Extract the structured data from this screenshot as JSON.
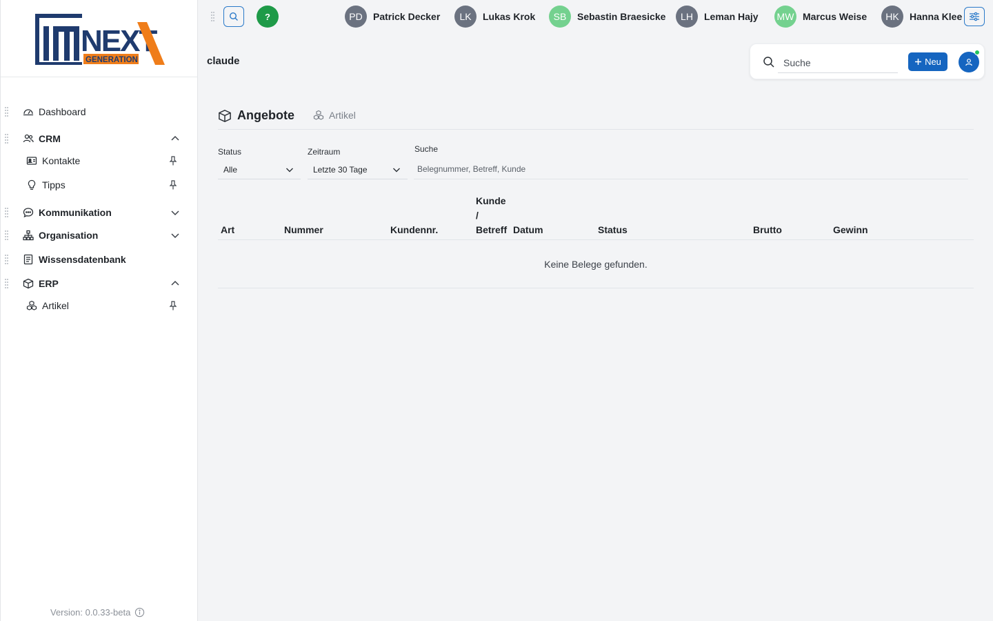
{
  "logo": {
    "text_main": "NEXT",
    "text_sub": "GENERATION"
  },
  "sidebar": {
    "items": [
      {
        "label": "Dashboard"
      },
      {
        "label": "CRM"
      },
      {
        "label": "Kontakte"
      },
      {
        "label": "Tipps"
      },
      {
        "label": "Kommunikation"
      },
      {
        "label": "Organisation"
      },
      {
        "label": "Wissensdatenbank"
      },
      {
        "label": "ERP"
      },
      {
        "label": "Artikel"
      }
    ],
    "version": "Version: 0.0.33-beta"
  },
  "topbar": {
    "help_label": "?",
    "users": [
      {
        "initials": "PD",
        "name": "Patrick Decker",
        "color": "#6b7280"
      },
      {
        "initials": "LK",
        "name": "Lukas Krok",
        "color": "#6b7280"
      },
      {
        "initials": "SB",
        "name": "Sebastin Braesicke",
        "color": "#74d18f"
      },
      {
        "initials": "LH",
        "name": "Leman Hajy",
        "color": "#6b7280"
      },
      {
        "initials": "MW",
        "name": "Marcus Weise",
        "color": "#74d18f"
      },
      {
        "initials": "HK",
        "name": "Hanna Klee",
        "color": "#6b7280"
      }
    ]
  },
  "header": {
    "current_user": "claude",
    "search_placeholder": "Suche",
    "new_label": "Neu"
  },
  "tabs": {
    "active": "Angebote",
    "second": "Artikel"
  },
  "filters": {
    "status_label": "Status",
    "status_value": "Alle",
    "period_label": "Zeitraum",
    "period_value": "Letzte 30 Tage",
    "search_label": "Suche",
    "search_placeholder": "Belegnummer, Betreff, Kunde"
  },
  "table": {
    "columns": {
      "art": "Art",
      "nummer": "Nummer",
      "kundennr": "Kundennr.",
      "kunde_1": "Kunde",
      "kunde_2": "/",
      "kunde_3": "Betreff",
      "datum": "Datum",
      "status": "Status",
      "brutto": "Brutto",
      "gewinn": "Gewinn"
    },
    "empty_text": "Keine Belege gefunden."
  },
  "colors": {
    "accent": "#1565c0",
    "help": "#1e9a48",
    "online": "#22c55e"
  }
}
